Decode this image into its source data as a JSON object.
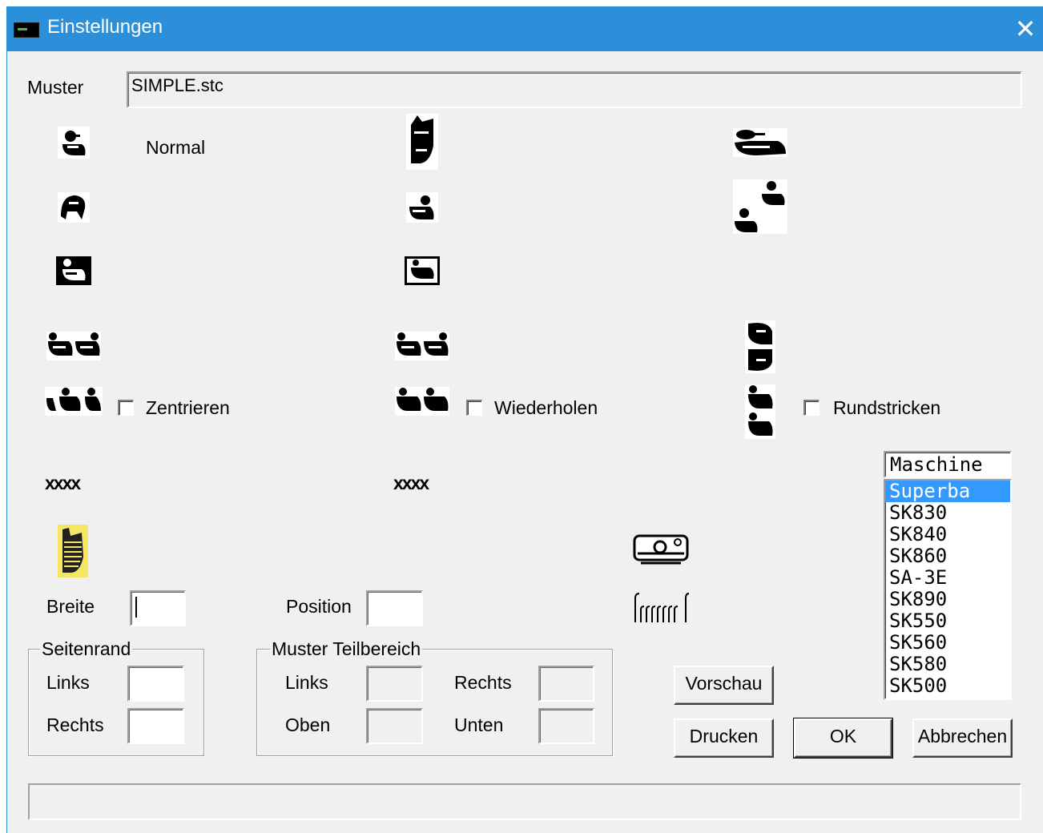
{
  "window": {
    "title": "Einstellungen",
    "close_glyph": "✕"
  },
  "muster": {
    "label": "Muster",
    "value": "SIMPLE.stc"
  },
  "options": {
    "normal_label": "Normal",
    "zentrieren_label": "Zentrieren",
    "wiederholen_label": "Wiederholen",
    "rundstricken_label": "Rundstricken",
    "zentrieren_checked": false,
    "wiederholen_checked": false,
    "rundstricken_checked": false
  },
  "icons": {
    "names": [
      "duck-normal-icon",
      "duck-mirror-vertical-icon",
      "duck-stretch-wide-icon",
      "duck-rotated-icon",
      "duck-small-icon",
      "duck-checkered-icon",
      "duck-negative-icon",
      "duck-negative-small-icon",
      "duck-double-wide-icon",
      "duck-double-icon",
      "duck-double-vertical-icon",
      "duck-row-center-icon",
      "duck-row-repeat-icon",
      "duck-row-circular-icon",
      "stitch-pattern-icon",
      "stitch-pattern-2-icon",
      "pattern-highlight-icon",
      "knitting-machine-icon",
      "needle-bed-icon"
    ],
    "stitch_text": "xxxx"
  },
  "breite": {
    "label": "Breite",
    "value": ""
  },
  "position": {
    "label": "Position",
    "value": ""
  },
  "seitenrand": {
    "title": "Seitenrand",
    "links_label": "Links",
    "links_value": "",
    "rechts_label": "Rechts",
    "rechts_value": ""
  },
  "teilbereich": {
    "title": "Muster Teilbereich",
    "links_label": "Links",
    "rechts_label": "Rechts",
    "oben_label": "Oben",
    "unten_label": "Unten"
  },
  "buttons": {
    "vorschau": "Vorschau",
    "drucken": "Drucken",
    "ok": "OK",
    "abbrechen": "Abbrechen"
  },
  "maschine": {
    "header": "Maschine",
    "items": [
      "Superba",
      "SK830",
      "SK840",
      "SK860",
      "SA-3E",
      "SK890",
      "SK550",
      "SK560",
      "SK580",
      "SK500"
    ],
    "selected": "Superba"
  },
  "colors": {
    "titlebar": "#2b90d9",
    "selection": "#3399ff",
    "dialog_bg": "#f0f0f0",
    "highlight_icon": "#f5e663"
  },
  "status_text": ""
}
